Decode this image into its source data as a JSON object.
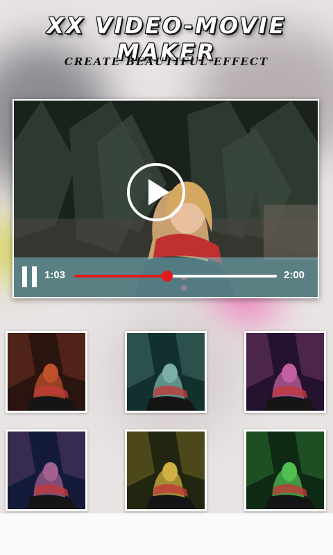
{
  "app": {
    "title": "XX VIDEO-MOVIE MAKER",
    "subtitle": "CREATE BEAUTIFUL EFFECT"
  },
  "player": {
    "current_time": "1:03",
    "total_time": "2:00",
    "progress_fraction": 0.46,
    "play_icon": "play-icon",
    "pause_icon": "pause-icon",
    "accent_color": "#e21b1b"
  },
  "effects": [
    {
      "name": "effect-red",
      "tint": "#c0502a",
      "bg": "#2a1410"
    },
    {
      "name": "effect-teal",
      "tint": "#7ab0a8",
      "bg": "#12302e"
    },
    {
      "name": "effect-purple",
      "tint": "#c060a0",
      "bg": "#24122e"
    },
    {
      "name": "effect-blue",
      "tint": "#a06090",
      "bg": "#141a3a"
    },
    {
      "name": "effect-olive",
      "tint": "#d0b040",
      "bg": "#202610"
    },
    {
      "name": "effect-green",
      "tint": "#50c050",
      "bg": "#0e2a14"
    }
  ]
}
